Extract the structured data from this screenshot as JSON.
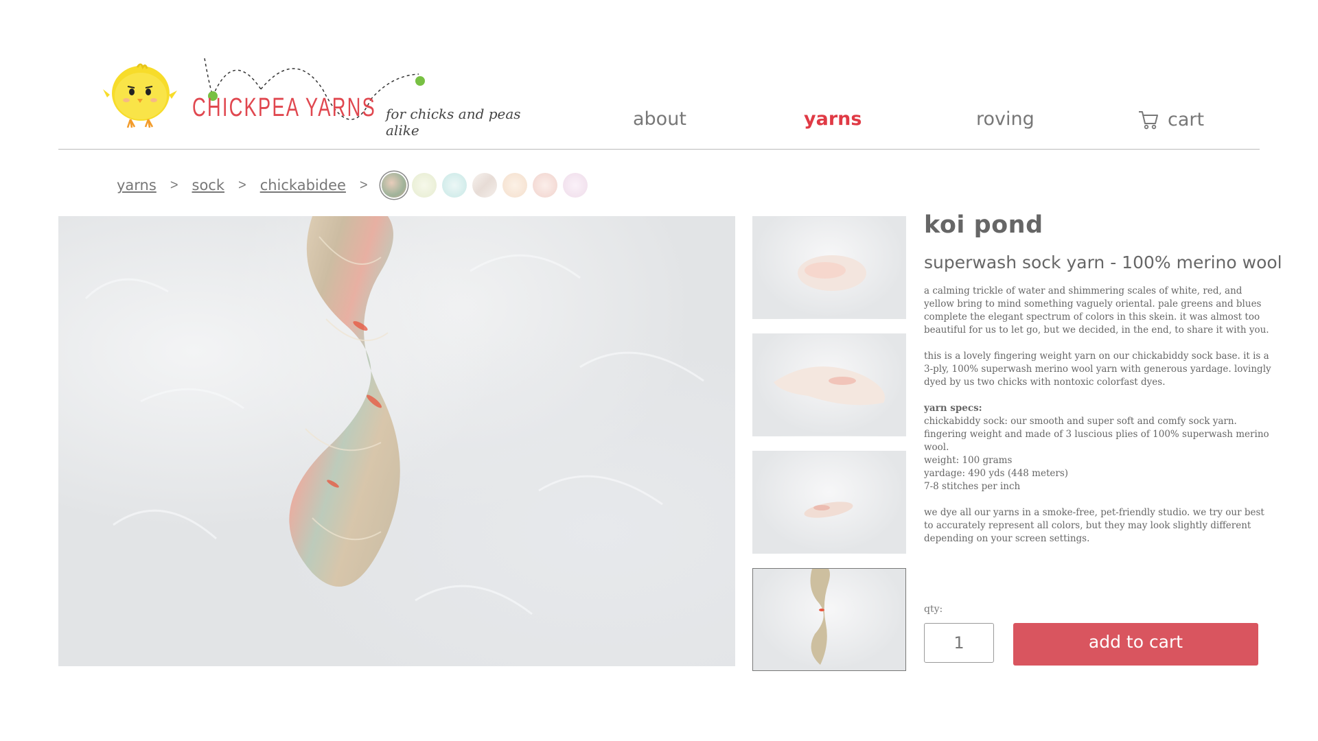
{
  "brand": {
    "name": "CHICKPEA YARNS",
    "tagline": "for chicks and peas alike"
  },
  "nav": {
    "about": "about",
    "yarns": "yarns",
    "roving": "roving",
    "cart": "cart",
    "active": "yarns"
  },
  "breadcrumb": {
    "items": [
      "yarns",
      "sock",
      "chickabidee"
    ],
    "separator": ">"
  },
  "swatches": [
    {
      "name": "koi pond",
      "selected": true,
      "color": "#b7c2ad"
    },
    {
      "name": "swatch-2",
      "color": "#eef2dd"
    },
    {
      "name": "swatch-3",
      "color": "#d5eeed"
    },
    {
      "name": "swatch-4",
      "color": "#f1ebe6"
    },
    {
      "name": "swatch-5",
      "color": "#f8e6d8"
    },
    {
      "name": "swatch-6",
      "color": "#f6e0dc"
    },
    {
      "name": "swatch-7",
      "color": "#f4e6f1"
    }
  ],
  "product": {
    "title": "koi pond",
    "subtitle": "superwash sock yarn - 100% merino wool",
    "description_1": "a calming trickle of water and shimmering scales of white, red, and yellow bring to mind something vaguely oriental. pale greens and blues complete the elegant spectrum of colors in this skein. it was almost too beautiful for us to let go, but we decided, in the end, to share it with you.",
    "description_2": "this is a lovely fingering weight yarn on our chickabiddy sock base. it is a 3-ply, 100% superwash merino wool yarn with generous yardage. lovingly dyed by us two chicks with nontoxic colorfast dyes.",
    "specs_title": "yarn specs:",
    "specs": [
      "chickabiddy sock: our smooth and super soft and comfy sock yarn. fingering weight and made of 3 luscious plies of 100% superwash merino wool.",
      "weight: 100 grams",
      "yardage: 490 yds (448 meters)",
      "7-8 stitches per inch"
    ],
    "disclaimer": "we dye all our yarns in a smoke-free, pet-friendly studio. we try our best to accurately represent all colors, but they may look slightly different depending on your screen settings.",
    "qty_label": "qty:",
    "qty_value": "1",
    "add_to_cart": "add to cart"
  },
  "thumbnails": [
    "skein-loose",
    "skein-twist-side",
    "skein-small",
    "skein-twist-vertical"
  ],
  "selected_thumbnail": 3,
  "colors": {
    "accent_red": "#e03a45",
    "button_red": "#d9555f",
    "text_gray": "#666666",
    "chick_yellow": "#f7dc2a",
    "pea_green": "#78c043"
  }
}
